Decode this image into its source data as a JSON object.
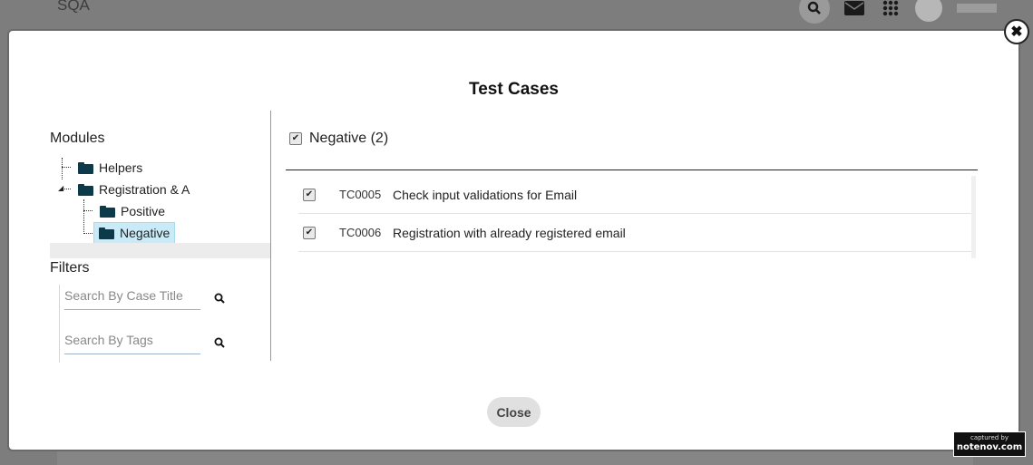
{
  "background": {
    "app_title": "SQA",
    "icons": [
      "search-icon",
      "envelope-icon",
      "apps-grid-icon",
      "user-avatar-icon"
    ]
  },
  "modal": {
    "title": "Test Cases",
    "close_icon": "close-icon",
    "modules_label": "Modules",
    "tree": [
      {
        "label": "Helpers",
        "level": 1,
        "selected": false
      },
      {
        "label": "Registration & A",
        "level": 1,
        "expanded": true,
        "selected": false
      },
      {
        "label": "Positive",
        "level": 2,
        "selected": false
      },
      {
        "label": "Negative",
        "level": 2,
        "selected": true
      }
    ],
    "filters_label": "Filters",
    "search_title_placeholder": "Search By Case Title",
    "search_tags_placeholder": "Search By Tags",
    "group": {
      "label": "Negative (2)",
      "checked": true
    },
    "cases": [
      {
        "id": "TC0005",
        "title": "Check input validations for Email",
        "checked": true
      },
      {
        "id": "TC0006",
        "title": "Registration with already registered email",
        "checked": true
      }
    ],
    "close_button": "Close"
  },
  "watermark": {
    "line1": "captured by",
    "line2": "notenov.com"
  },
  "colors": {
    "folder": "#0d3a4a",
    "selected_bg": "#c9ebf7",
    "overlay": "#7d7d7d"
  }
}
